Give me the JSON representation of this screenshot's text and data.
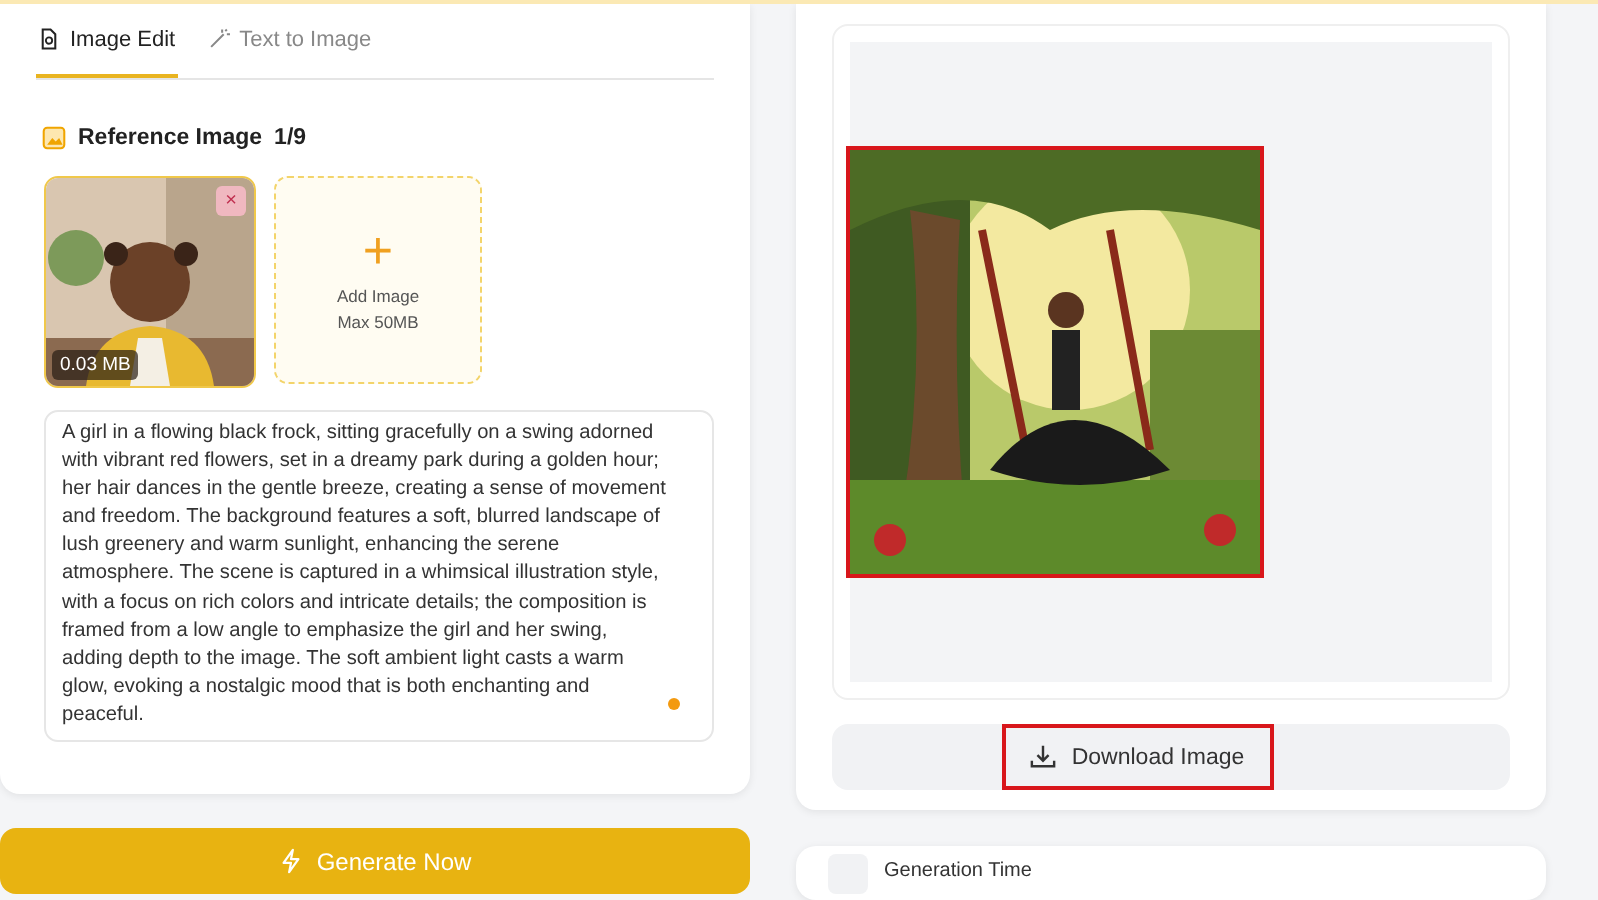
{
  "tabs": [
    {
      "label": "Image Edit",
      "selected": true
    },
    {
      "label": "Text to Image",
      "selected": false
    }
  ],
  "reference": {
    "title": "Reference Image",
    "count": "1/9",
    "thumbnails": [
      {
        "kind": "picture",
        "size": "0.03 MB",
        "remove": "×"
      }
    ],
    "add": {
      "icon": "+",
      "label": "Add Image",
      "hint": "Max 50MB"
    }
  },
  "prompt": {
    "value": "A girl in a flowing black frock, sitting gracefully on a swing adorned with vibrant red flowers, set in a dreamy park during a golden hour; her hair dances in the gentle breeze, creating a sense of movement and freedom. The background features a soft, blurred landscape of lush greenery and warm sunlight, enhancing the serene atmosphere. The scene is captured in a whimsical illustration style, with a focus on rich colors and intricate details; the composition is framed from a low angle to emphasize the girl and her swing, adding depth to the image. The soft ambient light casts a warm glow, evoking a nostalgic mood that is both enchanting and peaceful."
  },
  "generate_button": "Generate Now",
  "result": {
    "download_button": "Download Image"
  },
  "info": {
    "label": "Generation Time"
  }
}
